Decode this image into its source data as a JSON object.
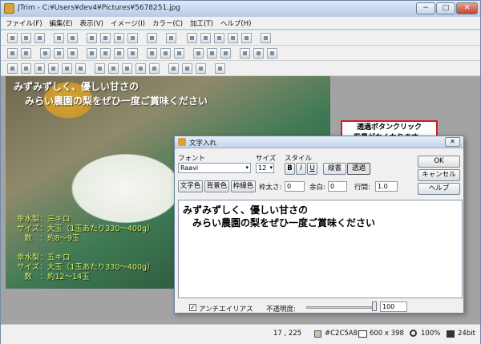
{
  "window": {
    "title": "JTrim - C:¥Users¥dev4¥Pictures¥5678251.jpg",
    "minimize": "−",
    "maximize": "□",
    "close": "✕"
  },
  "menu": [
    "ファイル(F)",
    "編集(E)",
    "表示(V)",
    "イメージ(I)",
    "カラー(C)",
    "加工(T)",
    "ヘルプ(H)"
  ],
  "image_text": {
    "line1": "みずみずしく、優しい甘さの",
    "line2": "みらい農園の梨をぜひ一度ご賞味ください",
    "block1": [
      "幸水梨：三キロ",
      "サイズ：大玉（1玉あたり330～400g）",
      "　数　：約8～9玉"
    ],
    "block2": [
      "幸水梨：五キロ",
      "サイズ：大玉（1玉あたり330～400g）",
      "　数　：約12～14玉"
    ]
  },
  "dialog": {
    "title": "文字入れ",
    "close": "✕",
    "font_label": "フォント",
    "font_value": "Raavi",
    "size_label": "サイズ",
    "size_value": "12",
    "style_label": "スタイル",
    "bold": "B",
    "italic": "I",
    "underline": "U",
    "vertical": "縦書",
    "transparent": "透過",
    "ok": "OK",
    "cancel": "キャンセル",
    "help": "ヘルプ",
    "text_color": "文字色",
    "bg_color": "背景色",
    "frame_color": "枠線色",
    "frame_width_label": "枠太さ:",
    "frame_width_value": "0",
    "margin_label": "余白:",
    "margin_value": "0",
    "line_spacing_label": "行間:",
    "line_spacing_value": "1.0",
    "text_line1": "みずみずしく、優しい甘さの",
    "text_line2": "　みらい農園の梨をぜひ一度ご賞味ください",
    "antialias_label": "アンチエイリアス",
    "antialias_checked": "✓",
    "opacity_label": "不透明度:",
    "opacity_value": "100"
  },
  "callout": {
    "line1": "透過ボタンクリック",
    "line2": "背景がなくなります。"
  },
  "status": {
    "coords": "17 , 225",
    "color": "#C2C5A8",
    "size": "600 x 398",
    "zoom": "100%",
    "depth": "24bit"
  }
}
